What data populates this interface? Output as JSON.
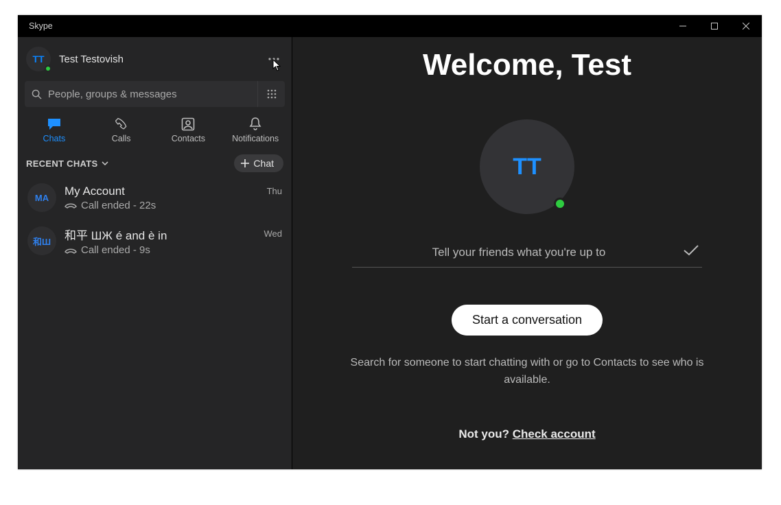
{
  "titlebar": {
    "title": "Skype"
  },
  "profile": {
    "initials": "TT",
    "name": "Test Testovish"
  },
  "search": {
    "placeholder": "People, groups & messages"
  },
  "tabs": {
    "chats": "Chats",
    "calls": "Calls",
    "contacts": "Contacts",
    "notifications": "Notifications"
  },
  "recent": {
    "label": "RECENT CHATS",
    "new_chat": "Chat"
  },
  "chats": [
    {
      "initials": "MA",
      "name": "My Account",
      "sub": "Call ended - 22s",
      "time": "Thu"
    },
    {
      "initials": "和Ш",
      "name": "和平 ШЖ é and è in",
      "sub": "Call ended - 9s",
      "time": "Wed"
    }
  ],
  "main": {
    "welcome": "Welcome, Test",
    "avatar_initials": "TT",
    "status_placeholder": "Tell your friends what you're up to",
    "start_button": "Start a conversation",
    "hint": "Search for someone to start chatting with or go to Contacts to see who is available.",
    "not_you_prefix": "Not you? ",
    "not_you_link": "Check account"
  }
}
